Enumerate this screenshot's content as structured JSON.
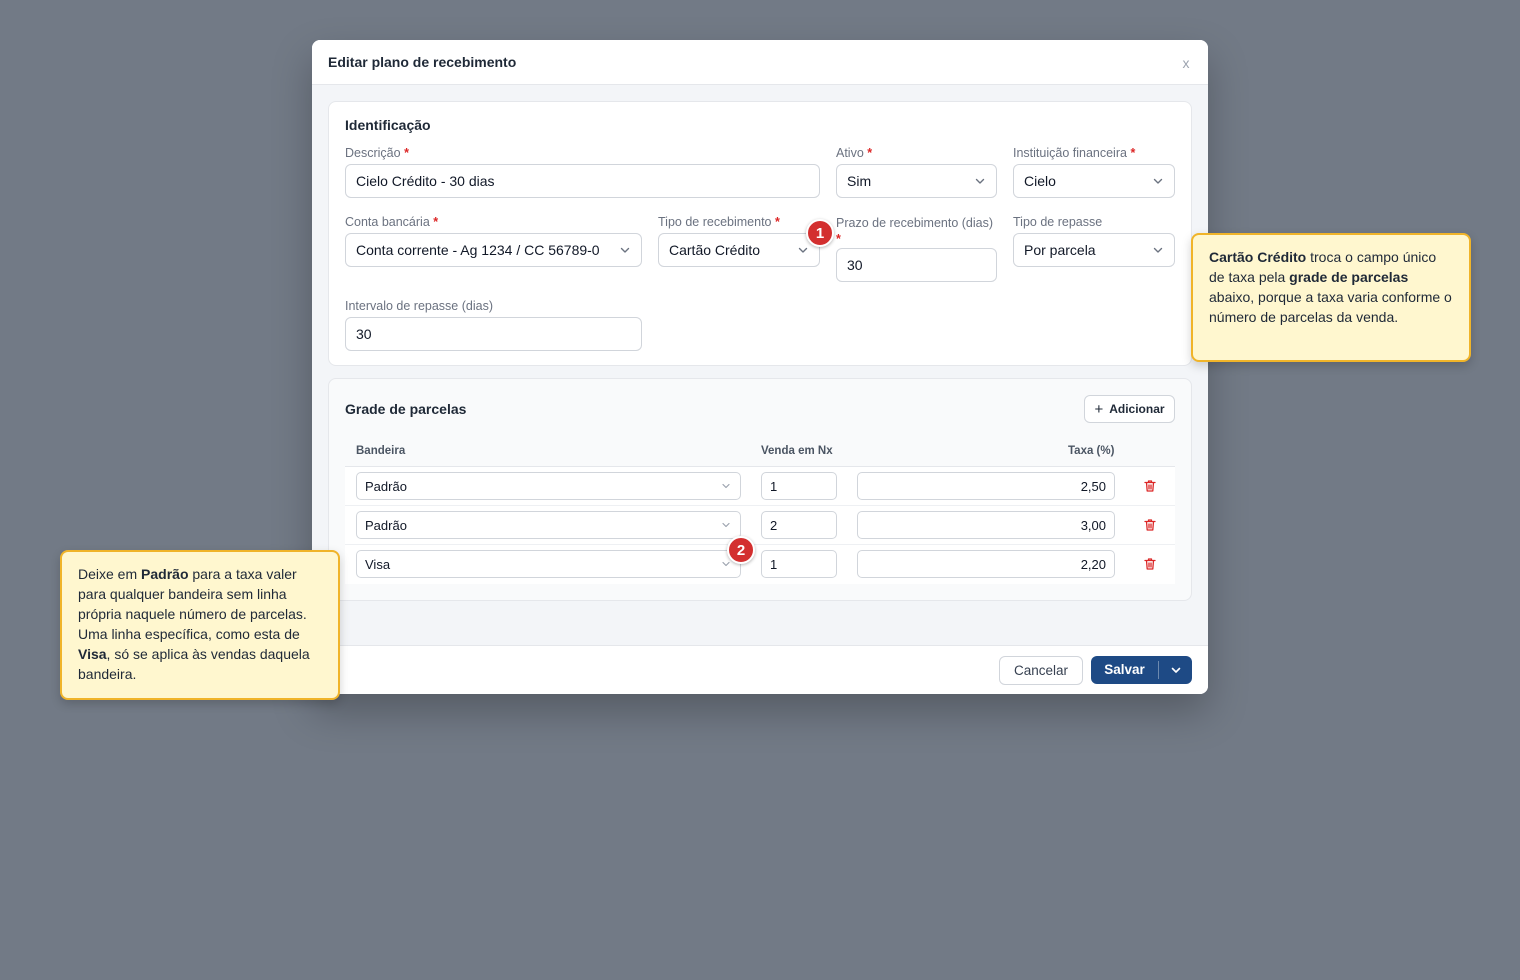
{
  "modal": {
    "title": "Editar plano de recebimento",
    "close_label": "x"
  },
  "identificacao": {
    "title": "Identificação",
    "descricao": {
      "label": "Descrição",
      "required": "*",
      "value": "Cielo Crédito - 30 dias"
    },
    "ativo": {
      "label": "Ativo",
      "required": "*",
      "value": "Sim"
    },
    "instituicao": {
      "label": "Instituição financeira",
      "required": "*",
      "value": "Cielo"
    },
    "conta": {
      "label": "Conta bancária",
      "required": "*",
      "value": "Conta corrente - Ag 1234 / CC 56789-0"
    },
    "tipo_recebimento": {
      "label": "Tipo de recebimento",
      "required": "*",
      "value": "Cartão Crédito"
    },
    "prazo": {
      "label": "Prazo de recebimento (dias)",
      "required": "*",
      "value": "30"
    },
    "tipo_repasse": {
      "label": "Tipo de repasse",
      "value": "Por parcela"
    },
    "intervalo": {
      "label": "Intervalo de repasse (dias)",
      "value": "30"
    }
  },
  "grade": {
    "title": "Grade de parcelas",
    "add_label": "Adicionar",
    "columns": {
      "bandeira": "Bandeira",
      "venda": "Venda em Nx",
      "taxa": "Taxa (%)"
    },
    "rows": [
      {
        "bandeira": "Padrão",
        "venda": "1",
        "taxa": "2,50"
      },
      {
        "bandeira": "Padrão",
        "venda": "2",
        "taxa": "3,00"
      },
      {
        "bandeira": "Visa",
        "venda": "1",
        "taxa": "2,20"
      }
    ]
  },
  "footer": {
    "cancel": "Cancelar",
    "save": "Salvar"
  },
  "badges": {
    "one": "1",
    "two": "2"
  },
  "tooltip1": {
    "b1": "Cartão Crédito",
    "t1": " troca o campo único de taxa pela ",
    "b2": "grade de parcelas",
    "t2": " abaixo, porque a taxa varia conforme o número de parcelas da venda."
  },
  "tooltip2": {
    "t1": "Deixe em ",
    "b1": "Padrão",
    "t2": " para a taxa valer para qualquer bandeira sem linha própria naquele número de parcelas. Uma linha específica, como esta de ",
    "b2": "Visa",
    "t3": ", só se aplica às vendas daquela bandeira."
  },
  "colors": {
    "accent": "#1e4a85",
    "danger": "#dc2626",
    "badge": "#d32f2f",
    "tooltip_bg": "#fff7cf",
    "tooltip_border": "#f0b429"
  },
  "icons": [
    "close-icon",
    "chevron-down-icon",
    "plus-icon",
    "trash-icon"
  ]
}
